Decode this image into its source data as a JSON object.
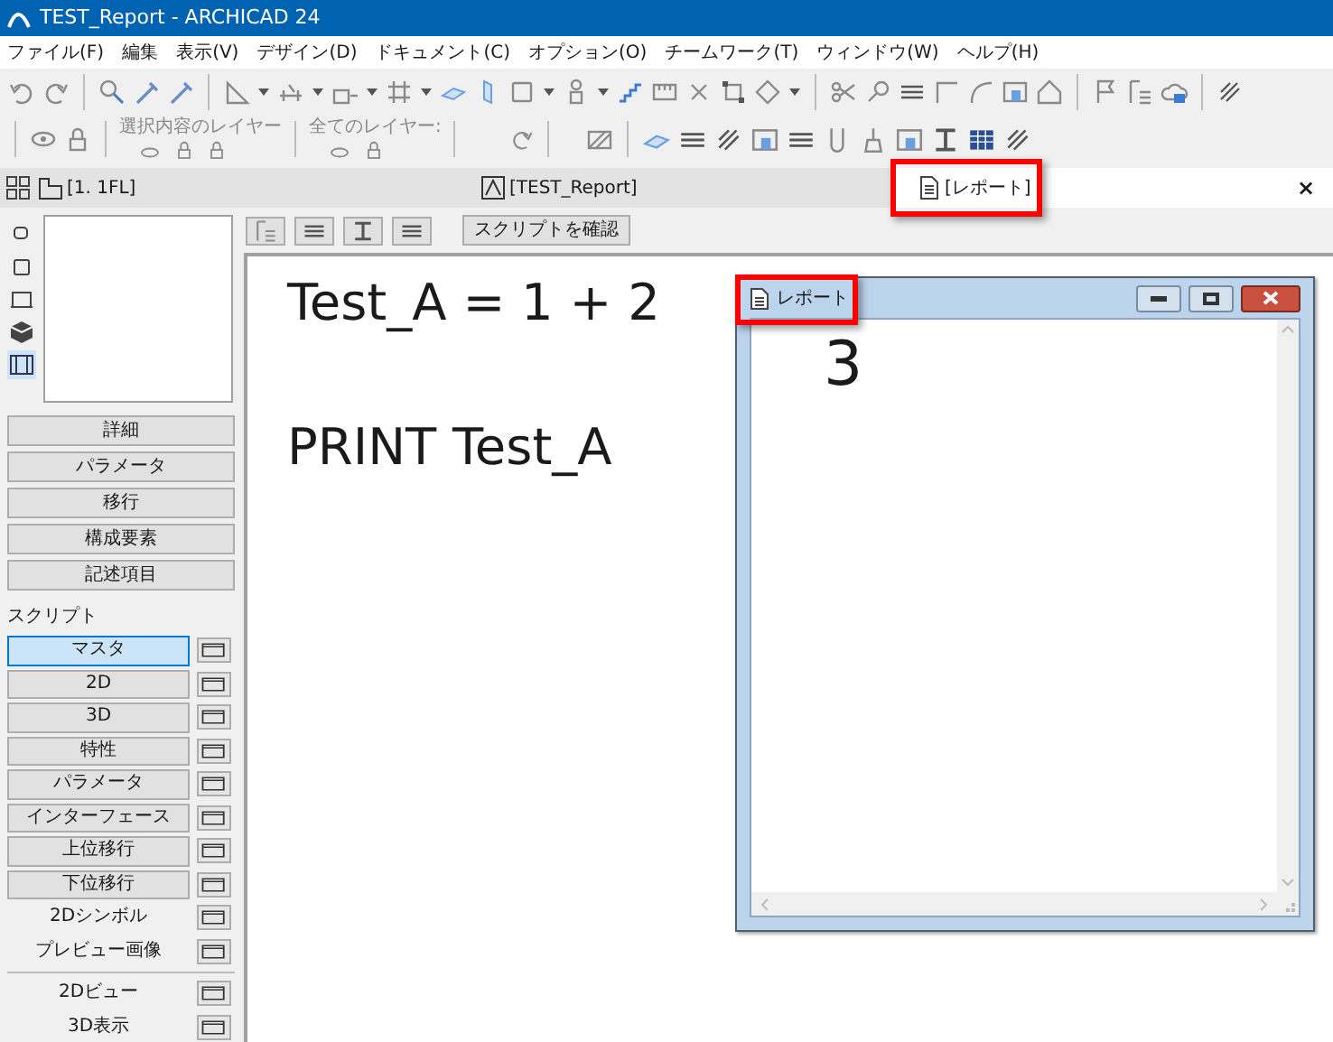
{
  "window": {
    "title": "TEST_Report - ARCHICAD 24"
  },
  "menu": [
    "ファイル(F)",
    "編集",
    "表示(V)",
    "デザイン(D)",
    "ドキュメント(C)",
    "オプション(O)",
    "チームワーク(T)",
    "ウィンドウ(W)",
    "ヘルプ(H)"
  ],
  "layer_toolbar": {
    "labels": [
      "選択内容のレイヤー",
      "全てのレイヤー:"
    ]
  },
  "tabs": [
    {
      "kind": "plan",
      "label": "[1. 1FL]",
      "selected": false,
      "highlighted": false
    },
    {
      "kind": "object",
      "label": "[TEST_Report]",
      "selected": false,
      "highlighted": false
    },
    {
      "kind": "report",
      "label": "[レポート]",
      "selected": true,
      "highlighted": true
    }
  ],
  "tab_close": "×",
  "view_icons": [
    {
      "selected": false
    },
    {
      "selected": false
    },
    {
      "selected": false
    },
    {
      "selected": false
    },
    {
      "selected": true
    }
  ],
  "section_buttons": [
    "詳細",
    "パラメータ",
    "移行",
    "構成要素",
    "記述項目"
  ],
  "script_label": "スクリプト",
  "scripts": [
    {
      "kind": "button",
      "label": "マスタ",
      "selected": true
    },
    {
      "kind": "button",
      "label": "2D",
      "selected": false
    },
    {
      "kind": "button",
      "label": "3D",
      "selected": false
    },
    {
      "kind": "button",
      "label": "特性",
      "selected": false
    },
    {
      "kind": "button",
      "label": "パラメータ",
      "selected": false
    },
    {
      "kind": "button",
      "label": "インターフェース",
      "selected": false
    },
    {
      "kind": "button",
      "label": "上位移行",
      "selected": false
    },
    {
      "kind": "button",
      "label": "下位移行",
      "selected": false
    },
    {
      "kind": "plain",
      "label": "2Dシンボル",
      "selected": false
    },
    {
      "kind": "plain",
      "label": "プレビュー画像",
      "selected": false
    }
  ],
  "views": [
    {
      "label": "2Dビュー"
    },
    {
      "label": "3D表示"
    }
  ],
  "editor": {
    "check_button": "スクリプトを確認",
    "lines": [
      "Test_A = 1 + 2",
      "PRINT Test_A"
    ]
  },
  "report_window": {
    "title": "レポート",
    "highlighted": true,
    "output": "3"
  }
}
